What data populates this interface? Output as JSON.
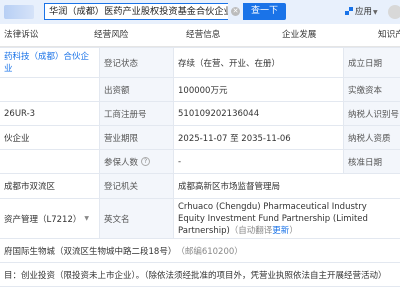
{
  "search": {
    "value": "华润（成都）医药产业股权投资基金合伙企业",
    "button": "查一下"
  },
  "header": {
    "apps_label": "应用"
  },
  "tabs": [
    "法律诉讼",
    "经营风险",
    "经营信息",
    "企业发展",
    "知识产"
  ],
  "rows": {
    "r1": {
      "name": "药科技（成都）合伙企业",
      "label": "登记状态",
      "value": "存续（在营、开业、在册）",
      "right": "成立日期"
    },
    "r2": {
      "label": "出资额",
      "value": "100000万元",
      "right": "实缴资本"
    },
    "r3": {
      "left": "26UR-3",
      "label": "工商注册号",
      "value": "510109202136044",
      "right": "纳税人识别号"
    },
    "r4": {
      "left": "伙企业",
      "label": "营业期限",
      "value": "2025-11-07 至 2035-11-06",
      "right": "纳税人资质"
    },
    "r5": {
      "label": "参保人数",
      "value": "-",
      "right": "核准日期"
    },
    "r6": {
      "left": "成都市双流区",
      "label": "登记机关",
      "value": "成都高新区市场监督管理局"
    },
    "r7": {
      "left": "资产管理（L7212）",
      "label": "英文名",
      "value": "Crhuaco (Chengdu) Pharmaceutical Industry Equity Investment Fund Partnership (Limited Partnership)",
      "note": "（自动翻译",
      "update": "更新",
      "close": "）"
    },
    "r8": {
      "text": "府国际生物城（双流区生物城中路二段18号）",
      "post": "（邮编610200）"
    },
    "r9": {
      "text": "目：创业投资（限投资未上市企业）。（除依法须经批准的项目外，凭营业执照依法自主开展经营活动）"
    }
  }
}
